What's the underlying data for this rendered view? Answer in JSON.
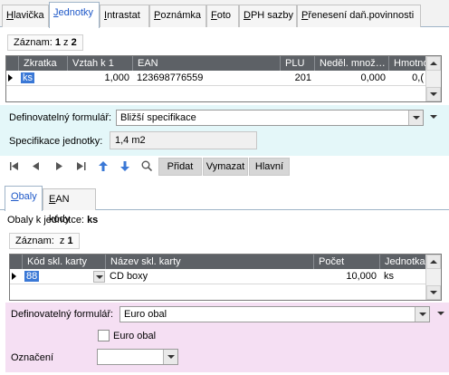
{
  "tabs_top": [
    {
      "label": "Hlavička",
      "ul": "H",
      "rest": "lavička"
    },
    {
      "label": "Jednotky",
      "ul": "J",
      "rest": "ednotky"
    },
    {
      "label": "Intrastat",
      "ul": "I",
      "rest": "ntrastat"
    },
    {
      "label": "Poznámka",
      "ul": "P",
      "rest": "oznámka"
    },
    {
      "label": "Foto",
      "ul": "F",
      "rest": "oto"
    },
    {
      "label": "DPH sazby",
      "ul": "D",
      "rest": "PH sazby"
    },
    {
      "label": "Přenesení daň.povinnosti",
      "ul": "P",
      "rest": "řenesení daň.povinnosti"
    }
  ],
  "units": {
    "counter": {
      "label": "Záznam:",
      "current": "1",
      "sep": "z",
      "total": "2"
    },
    "columns": [
      "Zkratka",
      "Vztah k 1",
      "EAN",
      "PLU",
      "Neděl. množ…",
      "Hmotno"
    ],
    "row": {
      "zkratka": "ks",
      "vztah": "1,000",
      "ean": "123698776559",
      "plu": "201",
      "nedel": "0,000",
      "hmot": "0,("
    },
    "form": {
      "definable_label": "Definovatelný formulář:",
      "definable_value": "Bližší specifikace",
      "spec_label": "Specifikace jednotky:",
      "spec_value": "1,4 m2"
    }
  },
  "toolbar": {
    "icons": [
      "first-record-icon",
      "prev-record-icon",
      "next-record-icon",
      "last-record-icon",
      "move-up-icon",
      "move-down-icon",
      "search-icon"
    ],
    "add": "Přidat",
    "delete": "Vymazat",
    "main": "Hlavní"
  },
  "subtabs": [
    {
      "label": "Obaly",
      "ul": "O",
      "rest": "baly"
    },
    {
      "label": "EAN kódy",
      "ul": "E",
      "rest": "AN kódy"
    }
  ],
  "packaging": {
    "caption_label": "Obaly k jednotce:",
    "caption_unit": "ks",
    "counter": {
      "label": "Záznam:",
      "sep": "z",
      "total": "1"
    },
    "columns": [
      "Kód skl. karty",
      "Název skl. karty",
      "Počet",
      "Jednotka"
    ],
    "row": {
      "kod": "88",
      "nazev": "CD boxy",
      "pocet": "10,000",
      "jednotka": "ks"
    },
    "form": {
      "definable_label": "Definovatelný formulář:",
      "definable_value": "Euro obal",
      "checkbox_label": "Euro obal",
      "oznaceni_label": "Označení",
      "oznaceni_value": ""
    }
  },
  "colors": {
    "accent": "#1e58c8",
    "grid_header": "#5d6166",
    "selection": "#3a78d6",
    "panel_cyan": "#e4f7f9",
    "panel_pink": "#f5dff3"
  }
}
